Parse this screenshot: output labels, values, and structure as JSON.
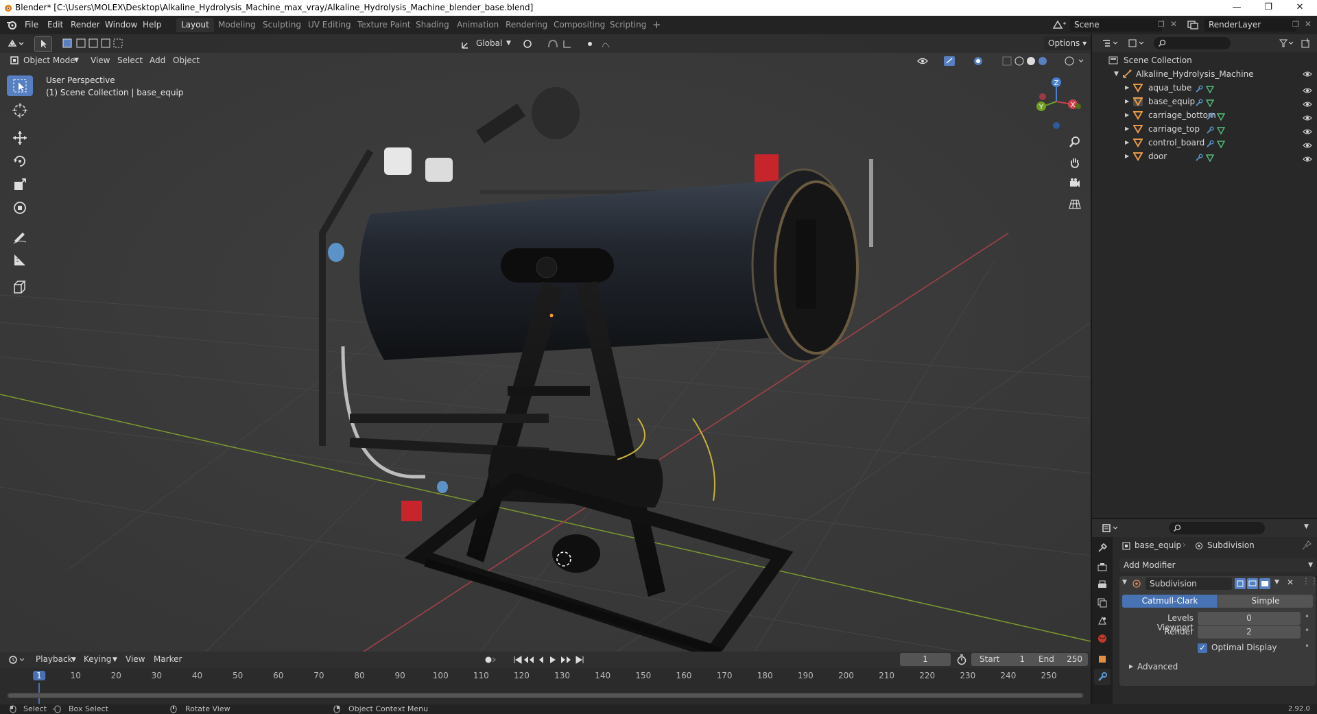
{
  "window": {
    "title": "Blender* [C:\\Users\\MOLEX\\Desktop\\Alkaline_Hydrolysis_Machine_max_vray/Alkaline_Hydrolysis_Machine_blender_base.blend]",
    "minimize": "—",
    "maximize": "❐",
    "close": "✕"
  },
  "menu": [
    "File",
    "Edit",
    "Render",
    "Window",
    "Help"
  ],
  "workspaces": [
    "Layout",
    "Modeling",
    "Sculpting",
    "UV Editing",
    "Texture Paint",
    "Shading",
    "Animation",
    "Rendering",
    "Compositing",
    "Scripting"
  ],
  "active_workspace": "Layout",
  "add_workspace": "+",
  "scene": {
    "name": "Scene",
    "view_layer": "RenderLayer"
  },
  "viewport": {
    "mode": "Object Mode",
    "menus": [
      "View",
      "Select",
      "Add",
      "Object"
    ],
    "transform_orientation": "Global",
    "options_label": "Options",
    "perspective_label": "User Perspective",
    "collection_label": "(1) Scene Collection | base_equip",
    "gizmo": {
      "x": "X",
      "y": "Y",
      "z": "Z"
    }
  },
  "outliner": {
    "root": "Scene Collection",
    "collection": "Alkaline_Hydrolysis_Machine",
    "objects": [
      "aqua_tube",
      "base_equip",
      "carriage_bottom",
      "carriage_top",
      "control_board",
      "door"
    ],
    "selected": "base_equip"
  },
  "properties": {
    "object_name": "base_equip",
    "modifier_tab": "Subdivision",
    "add_modifier": "Add Modifier",
    "modifier": {
      "name": "Subdivision",
      "types": [
        "Catmull-Clark",
        "Simple"
      ],
      "active_type": "Catmull-Clark",
      "levels_viewport_label": "Levels Viewport",
      "levels_viewport": "0",
      "render_label": "Render",
      "render_levels": "2",
      "optimal_display": "Optimal Display",
      "optimal_display_checked": true,
      "advanced": "Advanced"
    }
  },
  "timeline": {
    "menus": [
      "Playback",
      "Keying",
      "View",
      "Marker"
    ],
    "current_frame": "1",
    "start_label": "Start",
    "start": "1",
    "end_label": "End",
    "end": "250",
    "ticks": [
      "1",
      "10",
      "20",
      "30",
      "40",
      "50",
      "60",
      "70",
      "80",
      "90",
      "100",
      "110",
      "120",
      "130",
      "140",
      "150",
      "160",
      "170",
      "180",
      "190",
      "200",
      "210",
      "220",
      "230",
      "240",
      "250"
    ]
  },
  "statusbar": {
    "items": [
      "Select",
      "Box Select",
      "Rotate View",
      "Object Context Menu"
    ],
    "version": "2.92.0"
  }
}
